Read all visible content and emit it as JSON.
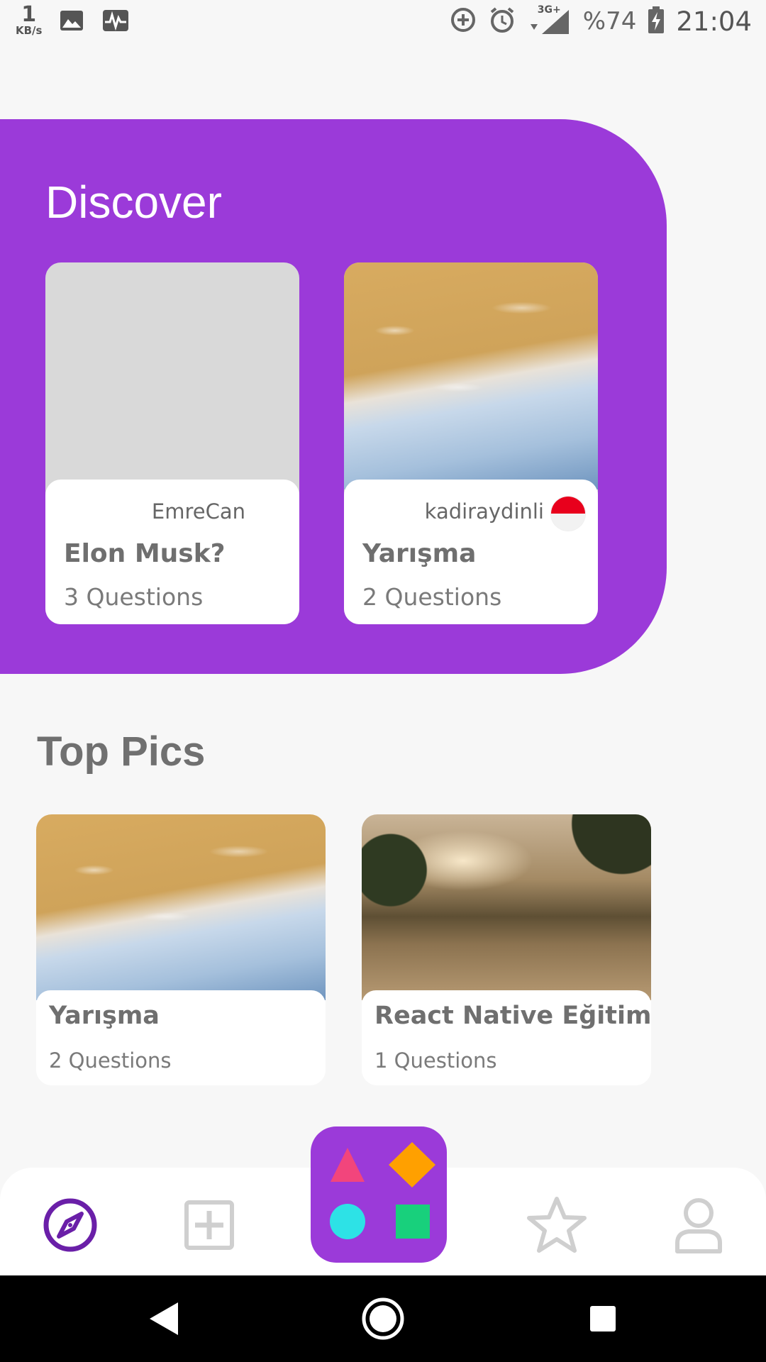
{
  "status_bar": {
    "net_speed_value": "1",
    "net_speed_unit": "KB/s",
    "battery_percent": "%74",
    "time": "21:04",
    "signal_label": "3G+"
  },
  "discover": {
    "title": "Discover",
    "cards": [
      {
        "author": "EmreCan",
        "title": "Elon Musk?",
        "count": "3 Questions",
        "image": "placeholder"
      },
      {
        "author": "kadiraydinli",
        "title": "Yarışma",
        "count": "2 Questions",
        "image": "beach",
        "flag": "red-white-flag"
      }
    ]
  },
  "top_pics": {
    "title": "Top Pics",
    "cards": [
      {
        "title": "Yarışma",
        "count": "2 Questions",
        "image": "beach"
      },
      {
        "title": "React Native Eğitimi",
        "count": "1 Questions",
        "image": "forest-lake"
      }
    ]
  },
  "tabbar": {
    "tabs": [
      "compass-icon",
      "add-square-icon",
      "shapes-icon",
      "star-icon",
      "user-icon"
    ],
    "active": "compass-icon",
    "colors": {
      "accent": "#9b3ad9",
      "active_icon": "#6a1fa8",
      "inactive_icon": "#cfcfcf",
      "shape_triangle": "#f2457c",
      "shape_diamond": "#ffa000",
      "shape_circle": "#2de2e6",
      "shape_square": "#18d07c"
    }
  }
}
